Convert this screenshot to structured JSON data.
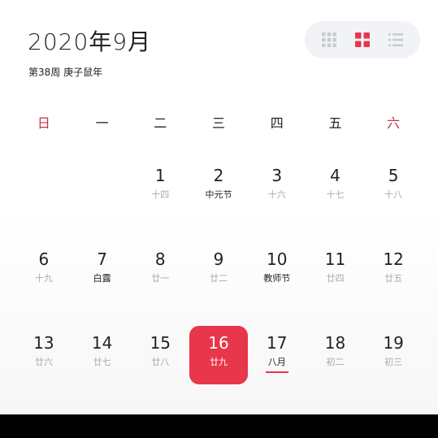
{
  "header": {
    "title": "2020年9月",
    "subtitle": "第38周 庚子鼠年"
  },
  "colors": {
    "accent": "#e8364a",
    "weekend": "#c8304a",
    "text": "#222222",
    "muted": "#aaaaaa"
  },
  "view_switch": {
    "buttons": [
      {
        "name": "month-grid-view",
        "icon": "grid-9-icon",
        "active": false
      },
      {
        "name": "week-grid-view",
        "icon": "grid-4-icon",
        "active": true
      },
      {
        "name": "list-view",
        "icon": "list-icon",
        "active": false
      }
    ]
  },
  "weekdays": [
    "日",
    "一",
    "二",
    "三",
    "四",
    "五",
    "六"
  ],
  "weeks": [
    [
      {
        "num": "",
        "lunar": ""
      },
      {
        "num": "",
        "lunar": ""
      },
      {
        "num": "1",
        "lunar": "十四"
      },
      {
        "num": "2",
        "lunar": "中元节",
        "festival": true
      },
      {
        "num": "3",
        "lunar": "十六"
      },
      {
        "num": "4",
        "lunar": "十七"
      },
      {
        "num": "5",
        "lunar": "十八"
      }
    ],
    [
      {
        "num": "6",
        "lunar": "十九"
      },
      {
        "num": "7",
        "lunar": "白露",
        "festival": true
      },
      {
        "num": "8",
        "lunar": "廿一"
      },
      {
        "num": "9",
        "lunar": "廿二"
      },
      {
        "num": "10",
        "lunar": "教师节",
        "festival": true
      },
      {
        "num": "11",
        "lunar": "廿四"
      },
      {
        "num": "12",
        "lunar": "廿五"
      }
    ],
    [
      {
        "num": "13",
        "lunar": "廿六"
      },
      {
        "num": "14",
        "lunar": "廿七"
      },
      {
        "num": "15",
        "lunar": "廿八"
      },
      {
        "num": "16",
        "lunar": "廿九",
        "selected": true
      },
      {
        "num": "17",
        "lunar": "八月",
        "festival": true,
        "underline": true
      },
      {
        "num": "18",
        "lunar": "初二"
      },
      {
        "num": "19",
        "lunar": "初三"
      }
    ]
  ]
}
